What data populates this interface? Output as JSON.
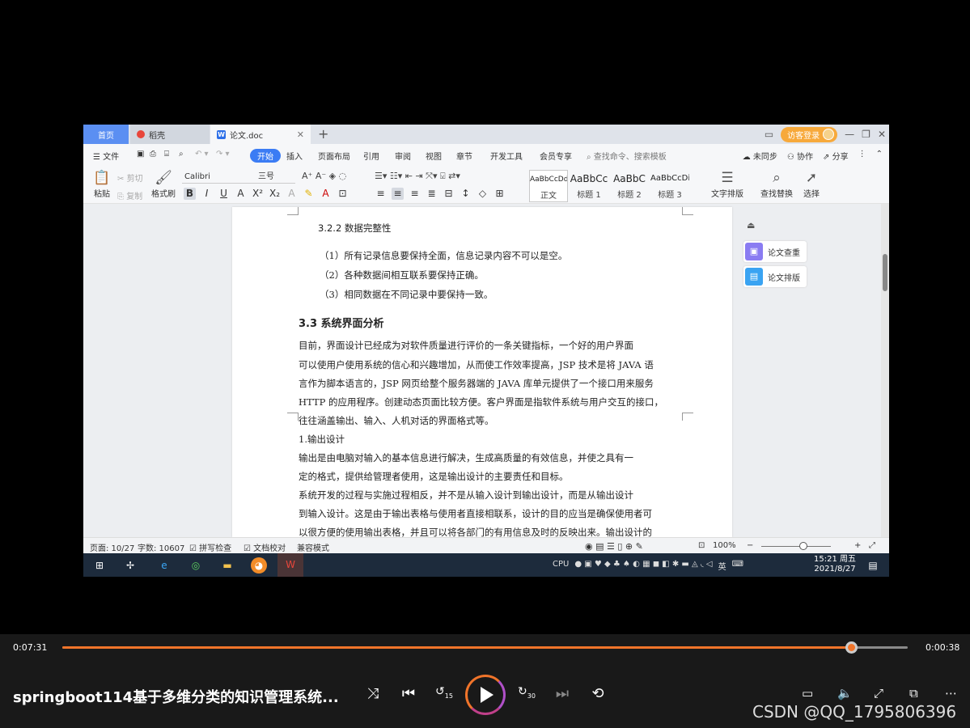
{
  "tabs": {
    "home": "首页",
    "daoke": "稻壳",
    "doc": "论文.doc",
    "add": "+",
    "login": "访客登录"
  },
  "menus": [
    "文件",
    "开始",
    "插入",
    "页面布局",
    "引用",
    "审阅",
    "视图",
    "章节",
    "开发工具",
    "会员专享"
  ],
  "search_cmd": "查找命令、搜索模板",
  "menu_right": {
    "sync": "未同步",
    "collab": "协作",
    "share": "分享"
  },
  "ribbon": {
    "paste": "粘贴",
    "cut": "剪切",
    "copy": "复制",
    "format_painter": "格式刷",
    "font": "Calibri",
    "size": "三号",
    "styles": [
      {
        "sample": "AaBbCcDd",
        "name": "正文"
      },
      {
        "sample": "AaBbCc",
        "name": "标题 1"
      },
      {
        "sample": "AaBbC",
        "name": "标题 2"
      },
      {
        "sample": "AaBbCcDi",
        "name": "标题 3"
      }
    ],
    "text_layout": "文字排版",
    "find_replace": "查找替换",
    "select": "选择"
  },
  "document": {
    "h_322": "3.2.2 数据完整性",
    "p1": "（1）所有记录信息要保持全面，信息记录内容不可以是空。",
    "p2": "（2）各种数据间相互联系要保持正确。",
    "p3": "（3）相同数据在不同记录中要保持一致。",
    "h_33": "3.3 系统界面分析",
    "body": [
      "    目前，界面设计已经成为对软件质量进行评价的一条关键指标，一个好的用户界面",
      "可以使用户使用系统的信心和兴趣增加，从而使工作效率提高，JSP 技术是将 JAVA 语",
      "言作为脚本语言的，JSP 网页给整个服务器端的 JAVA 库单元提供了一个接口用来服务",
      "HTTP 的应用程序。创建动态页面比较方便。客户界面是指软件系统与用户交互的接口，",
      "往往涵盖输出、输入、人机对话的界面格式等。",
      "    1.输出设计",
      "    输出是由电脑对输入的基本信息进行解决，生成高质量的有效信息，并使之具有一",
      "定的格式，提供给管理者使用，这是输出设计的主要责任和目标。",
      "    系统开发的过程与实施过程相反，并不是从输入设计到输出设计，而是从输出设计",
      "到输入设计。这是由于输出表格与使用者直接相联系，设计的目的应当是确保使用者可",
      "以很方便的使用输出表格，并且可以将各部门的有用信息及时的反映出来。输出设计的"
    ]
  },
  "side_panel": {
    "check": "论文查重",
    "layout": "论文排版"
  },
  "status": {
    "page": "页面: 10/27",
    "words": "字数: 10607",
    "spell": "拼写检查",
    "proof": "文档校对",
    "compat": "兼容模式",
    "zoom": "100%",
    "zoom_level": 0.6
  },
  "taskbar": {
    "ime": "英",
    "time": "15:21 周五",
    "date": "2021/8/27",
    "cpu": "CPU"
  },
  "player": {
    "current": "0:07:31",
    "total": "0:00:38",
    "progress": 0.933,
    "title": "springboot114基于多维分类的知识管理系统...",
    "watermark": "CSDN @QQ_1795806396",
    "skip_back": "15",
    "skip_fwd": "30"
  },
  "colors": {
    "accent": "#f0742a",
    "wps_blue": "#3b7cf4"
  }
}
